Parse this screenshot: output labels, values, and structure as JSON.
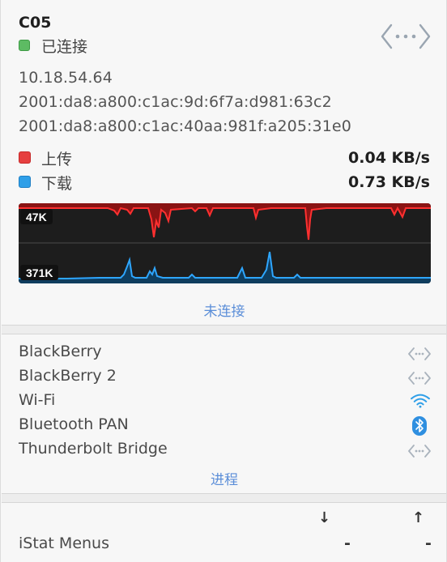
{
  "header": {
    "title": "C05",
    "status": "已连接",
    "status_color": "#5dbb63"
  },
  "addresses": [
    "10.18.54.64",
    "2001:da8:a800:c1ac:9d:6f7a:d981:63c2",
    "2001:da8:a800:c1ac:40aa:981f:a205:31e0"
  ],
  "traffic": {
    "upload": {
      "label": "上传",
      "value": "0.04 KB/s",
      "color": "#e64040"
    },
    "download": {
      "label": "下载",
      "value": "0.73 KB/s",
      "color": "#2f9fe8"
    }
  },
  "graph": {
    "upload_peak": "47K",
    "download_peak": "371K"
  },
  "links": {
    "disconnected": "未连接",
    "processes": "进程"
  },
  "interfaces": [
    {
      "name": "BlackBerry",
      "icon": "ethernet-icon"
    },
    {
      "name": "BlackBerry 2",
      "icon": "ethernet-icon"
    },
    {
      "name": "Wi-Fi",
      "icon": "wifi-icon"
    },
    {
      "name": "Bluetooth PAN",
      "icon": "bluetooth-icon"
    },
    {
      "name": "Thunderbolt Bridge",
      "icon": "ethernet-icon"
    }
  ],
  "process_table": {
    "columns": [
      "↓",
      "↑"
    ],
    "rows": [
      {
        "name": "iStat Menus",
        "down": "-",
        "up": "-"
      }
    ]
  }
}
